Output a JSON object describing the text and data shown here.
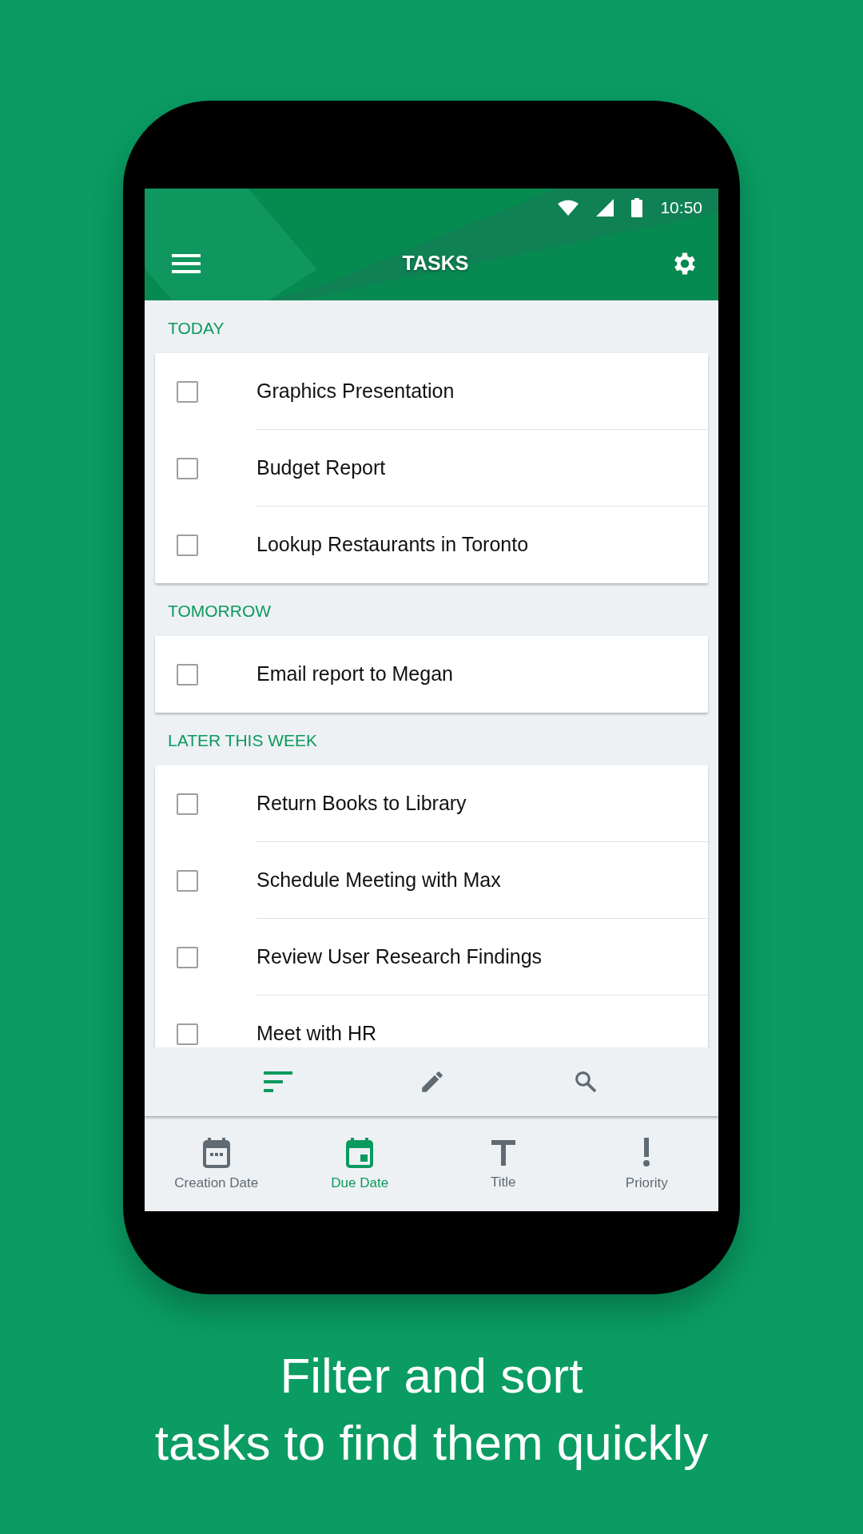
{
  "status_bar": {
    "time": "10:50"
  },
  "app_bar": {
    "title": "TASKS"
  },
  "sections": [
    {
      "title": "TODAY",
      "tasks": [
        {
          "label": "Graphics Presentation",
          "checked": false
        },
        {
          "label": "Budget Report",
          "checked": false
        },
        {
          "label": "Lookup Restaurants in Toronto",
          "checked": false
        }
      ]
    },
    {
      "title": "TOMORROW",
      "tasks": [
        {
          "label": "Email report to Megan",
          "checked": false
        }
      ]
    },
    {
      "title": "LATER THIS WEEK",
      "tasks": [
        {
          "label": "Return Books to Library",
          "checked": false
        },
        {
          "label": "Schedule Meeting with Max",
          "checked": false
        },
        {
          "label": "Review User Research Findings",
          "checked": false
        },
        {
          "label": "Meet with HR",
          "checked": false
        }
      ]
    }
  ],
  "toolbar": [
    {
      "kind": "sort",
      "selected": true
    },
    {
      "kind": "edit",
      "selected": false
    },
    {
      "kind": "search",
      "selected": false
    }
  ],
  "bottom_nav": [
    {
      "kind": "calendar",
      "label": "Creation Date",
      "selected": false
    },
    {
      "kind": "calendar-day",
      "label": "Due Date",
      "selected": true
    },
    {
      "kind": "title",
      "label": "Title",
      "selected": false
    },
    {
      "kind": "priority",
      "label": "Priority",
      "selected": false
    }
  ],
  "caption": {
    "lines": [
      "Filter and sort",
      "tasks to find them quickly"
    ]
  }
}
